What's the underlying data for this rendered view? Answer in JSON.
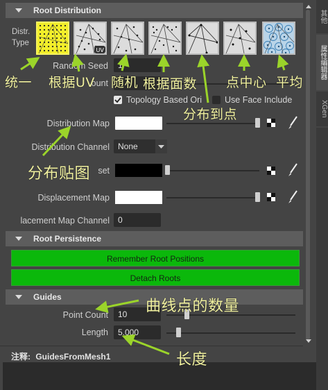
{
  "sections": {
    "root_distribution": "Root Distribution",
    "root_persistence": "Root Persistence",
    "guides": "Guides"
  },
  "distr_type_label": [
    "Distr.",
    "Type"
  ],
  "labels": {
    "random_seed": "Random Seed",
    "count": "ount",
    "distribution_map": "Distribution Map",
    "distribution_channel": "Distribution Channel",
    "offset": "set",
    "displacement_map": "Displacement Map",
    "displacement_map_channel": "lacement Map Channel",
    "point_count": "Point Count",
    "length": "Length"
  },
  "values": {
    "random_seed": "1",
    "distribution_channel": "None",
    "displacement_map_channel": "0",
    "point_count": "10",
    "length": "5.000"
  },
  "checks": {
    "topology_based": "Topology Based Ori",
    "use_face_include": "Use Face Include"
  },
  "buttons": {
    "remember_root_positions": "Remember Root Positions",
    "detach_roots": "Detach Roots"
  },
  "footer": {
    "note_label": "注释:",
    "note_value": "GuidesFromMesh1"
  },
  "right_tabs": [
    "其他",
    "属性编辑器",
    "XGen"
  ],
  "annotations": {
    "uniform": "统一",
    "by_uv": "根据UV",
    "random": "随机",
    "by_face_count": "根据面数",
    "to_points": "分布到点",
    "point_center": "点中心",
    "average": "平均",
    "distribution_map": "分布贴图",
    "curve_point_count": "曲线点的数量",
    "length": "长度"
  },
  "colors": {
    "green_button": "#0bb80b",
    "annotation_text": "#f1f1a0",
    "annotation_arrow": "#9bd42a",
    "selected_type": "#f2ee2a"
  }
}
